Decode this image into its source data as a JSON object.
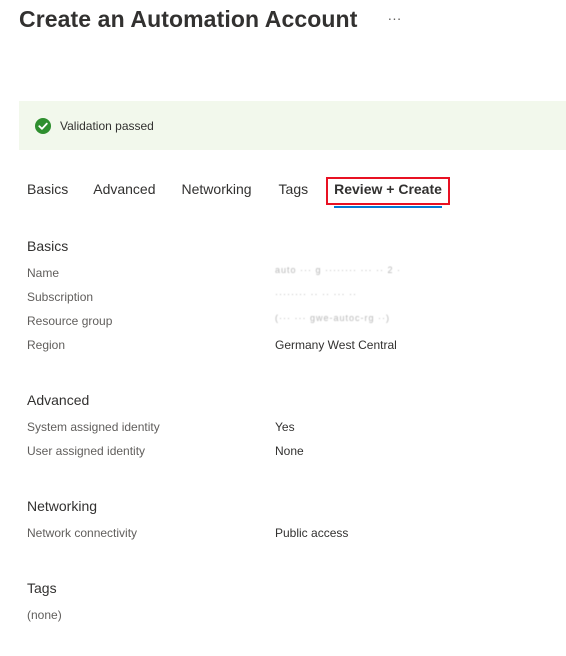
{
  "header": {
    "title": "Create an Automation Account",
    "more_label": "···"
  },
  "banner": {
    "icon": "check-circle-icon",
    "text": "Validation passed",
    "color": "#2f8f2f",
    "background": "#f2f8ec"
  },
  "tabs": [
    {
      "label": "Basics",
      "active": false
    },
    {
      "label": "Advanced",
      "active": false
    },
    {
      "label": "Networking",
      "active": false
    },
    {
      "label": "Tags",
      "active": false
    },
    {
      "label": "Review + Create",
      "active": true
    }
  ],
  "accent": {
    "tab_underline": "#0078d4",
    "highlight_box": "#e81123"
  },
  "basics": {
    "title": "Basics",
    "rows": [
      {
        "label": "Name",
        "value": "auto ··· g ········ ··· ·· 2 ·"
      },
      {
        "label": "Subscription",
        "value": "········ ·· ·· ··· ··"
      },
      {
        "label": "Resource group",
        "value": "(··· ··· gwe-autoc-rg ··)"
      },
      {
        "label": "Region",
        "value": "Germany West Central"
      }
    ]
  },
  "advanced": {
    "title": "Advanced",
    "rows": [
      {
        "label": "System assigned identity",
        "value": "Yes"
      },
      {
        "label": "User assigned identity",
        "value": "None"
      }
    ]
  },
  "networking": {
    "title": "Networking",
    "rows": [
      {
        "label": "Network connectivity",
        "value": "Public access"
      }
    ]
  },
  "tags": {
    "title": "Tags",
    "empty_text": "(none)"
  }
}
